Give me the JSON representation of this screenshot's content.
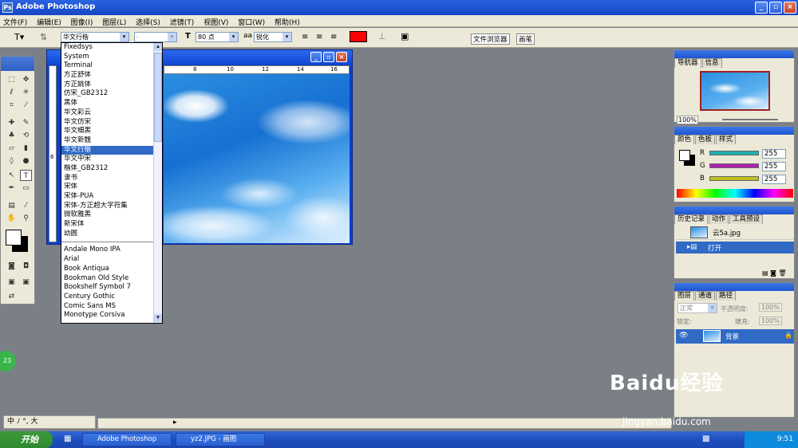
{
  "window": {
    "title": "Adobe Photoshop",
    "logo": "Ps"
  },
  "menu": [
    "文件(F)",
    "编辑(E)",
    "图像(I)",
    "图层(L)",
    "选择(S)",
    "滤镜(T)",
    "视图(V)",
    "窗口(W)",
    "帮助(H)"
  ],
  "options": {
    "font_family": "华文行楷",
    "font_style": "-",
    "font_size": "80 点",
    "aa_label": "aa",
    "antialias": "锐化",
    "color_swatch": "#ff0000",
    "tabs": [
      "文件浏览器",
      "画笔"
    ]
  },
  "font_list": {
    "group1": [
      "Fixedsys",
      "System",
      "Terminal",
      "方正舒体",
      "方正姚体",
      "仿宋_GB2312",
      "黑体",
      "华文彩云",
      "华文仿宋",
      "华文细黑",
      "华文新魏",
      "华文行楷",
      "华文中宋",
      "楷体_GB2312",
      "隶书",
      "宋体",
      "宋体-PUA",
      "宋体-方正超大字符集",
      "微软雅黑",
      "新宋体",
      "幼圆"
    ],
    "selected": "华文行楷",
    "group2": [
      "Andale Mono IPA",
      "Arial",
      "Book Antiqua",
      "Bookman Old Style",
      "Bookshelf Symbol 7",
      "Century Gothic",
      "Comic Sans MS",
      "Monotype Corsiva"
    ]
  },
  "ruler": {
    "marks": [
      "8",
      "10",
      "12",
      "14",
      "16"
    ],
    "left": "6"
  },
  "navigator": {
    "tabs": [
      "导航器",
      "信息"
    ],
    "zoom": "100%"
  },
  "color_panel": {
    "tabs": [
      "颜色",
      "色板",
      "样式"
    ],
    "channels": [
      {
        "name": "R",
        "value": "255",
        "color": "#23b0b0"
      },
      {
        "name": "G",
        "value": "255",
        "color": "#b020b0"
      },
      {
        "name": "B",
        "value": "255",
        "color": "#c0c020"
      }
    ]
  },
  "history": {
    "tabs": [
      "历史记录",
      "动作",
      "工具预设"
    ],
    "snapshot": "云5a.jpg",
    "items": [
      "打开"
    ]
  },
  "layers": {
    "tabs": [
      "图层",
      "通道",
      "路径"
    ],
    "blend": "正常",
    "opacity_label": "不透明度:",
    "opacity": "100%",
    "lock_label": "锁定:",
    "fill_label": "填充:",
    "fill": "100%",
    "layer_name": "背景"
  },
  "taskbar": {
    "start": "开始",
    "tasks": [
      "Adobe Photoshop",
      "yz2.JPG - 画图"
    ],
    "time": "9:51"
  },
  "ime": "中 ﾉ °, 大",
  "badge": "23",
  "watermark": {
    "logo": "Baidu经验",
    "url": "jingyan.baidu.com"
  }
}
